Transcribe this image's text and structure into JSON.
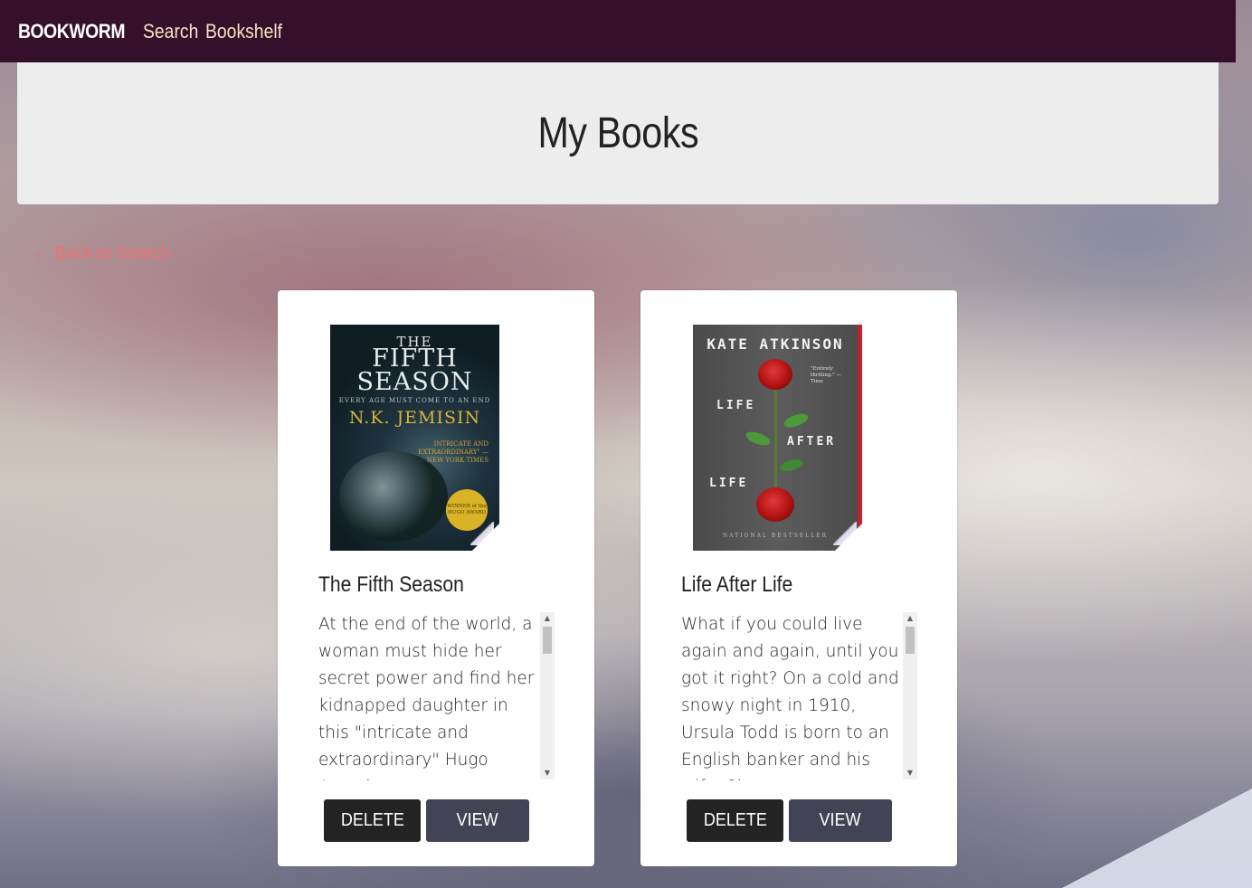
{
  "navbar": {
    "brand": "BOOKWORM",
    "links": [
      "Search",
      "Bookshelf"
    ]
  },
  "header": {
    "title": "My Books"
  },
  "back_link": "← Back to Search",
  "books": [
    {
      "title": "The Fifth Season",
      "description": "At the end of the world, a woman must hide her secret power and find her kidnapped daughter in this \"intricate and extraordinary\" Hugo Award",
      "cover": {
        "top": "THE",
        "line1": "FIFTH",
        "line2": "SEASON",
        "tagline": "EVERY AGE MUST COME TO AN END",
        "author": "N.K. JEMISIN",
        "quote": "INTRICATE AND EXTRAORDINARY\" —NEW YORK TIMES",
        "badge": "WINNER of the HUGO AWARD"
      },
      "delete_label": "DELETE",
      "view_label": "VIEW"
    },
    {
      "title": "Life After Life",
      "description": "What if you could live again and again, until you got it right? On a cold and snowy night in 1910, Ursula Todd is born to an English banker and his wife. She",
      "cover": {
        "author": "KATE ATKINSON",
        "line1": "LIFE",
        "line2": "AFTER",
        "line3": "LIFE",
        "blurb": "\"Entirely thrilling.\" —Time",
        "footer": "NATIONAL BESTSELLER"
      },
      "delete_label": "DELETE",
      "view_label": "VIEW"
    }
  ],
  "colors": {
    "navbar": "#34102a",
    "nav_link": "#f4e2c4",
    "back_link": "#f07070",
    "delete_button": "#232323",
    "view_button": "#434356"
  },
  "icons": {
    "scroll_up": "▲",
    "scroll_down": "▼"
  }
}
